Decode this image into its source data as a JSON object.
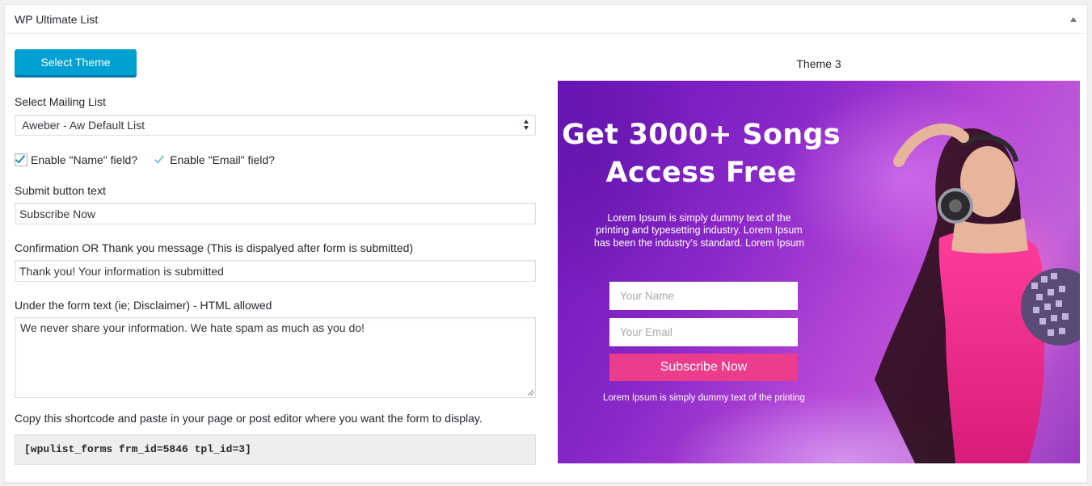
{
  "panel": {
    "title": "WP Ultimate List"
  },
  "select_theme_label": "Select Theme",
  "mailing_list": {
    "label": "Select Mailing List",
    "selected": "Aweber - Aw Default List"
  },
  "checkboxes": [
    {
      "label": "Enable \"Name\" field?",
      "checked": true
    },
    {
      "label": "Enable \"Email\" field?",
      "checked": true
    }
  ],
  "submit_text": {
    "label": "Submit button text",
    "value": "Subscribe Now"
  },
  "confirmation": {
    "label": "Confirmation OR Thank you message (This is dispalyed after form is submitted)",
    "value": "Thank you! Your information is submitted"
  },
  "under_form": {
    "label": "Under the form text (ie; Disclaimer) - HTML allowed",
    "value": "We never share your information. We hate spam as much as you do!"
  },
  "shortcode": {
    "instructions": "Copy this shortcode and paste in your page or post editor where you want the form to display.",
    "code": "[wpulist_forms frm_id=5846 tpl_id=3]"
  },
  "preview": {
    "theme_name": "Theme 3",
    "headline_line1": "Get 3000+ Songs",
    "headline_line2": "Access Free",
    "body_line1": "Lorem Ipsum is simply dummy text of the",
    "body_line2": "printing and typesetting industry. Lorem Ipsum",
    "body_line3": "has been the industry's standard. Lorem Ipsum",
    "name_placeholder": "Your Name",
    "email_placeholder": "Your Email",
    "button_label": "Subscribe Now",
    "footer_text": "Lorem Ipsum is simply dummy text of the printing"
  },
  "colors": {
    "primary_button": "#00a0d2",
    "preview_button": "#ec3d8c",
    "preview_bg": "#8a28c8"
  }
}
